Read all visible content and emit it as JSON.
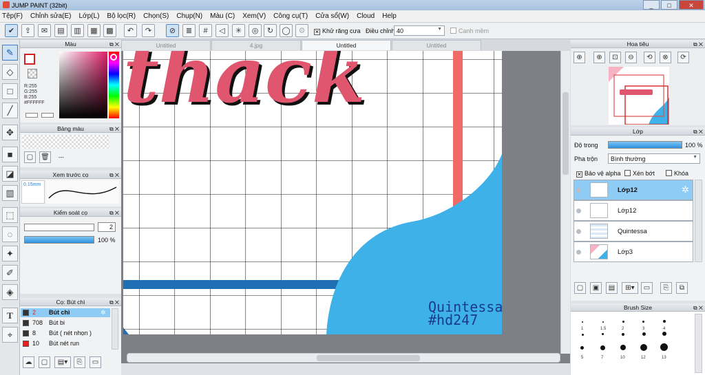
{
  "app": {
    "title": "JUMP PAINT (32bit)"
  },
  "menu": [
    "Tệp(F)",
    "Chỉnh sửa(E)",
    "Lớp(L)",
    "Bộ lọc(R)",
    "Chọn(S)",
    "Chụp(N)",
    "Màu (C)",
    "Xem(V)",
    "Công cụ(T)",
    "Cửa sổ(W)",
    "Cloud",
    "Help"
  ],
  "toolbar": {
    "antialias_label": "Khử răng cưa",
    "adjust_label": "Điều chỉnh",
    "adjust_value": "40",
    "ruler_label": "Canh mềm"
  },
  "tabs": [
    "Untitled",
    "4.jpg",
    "Untitled",
    "Untitled"
  ],
  "panels": {
    "color": {
      "title": "Màu",
      "r": "R:255",
      "g": "G:255",
      "b": "B:255",
      "hex": "#FFFFFF"
    },
    "swatch": {
      "title": "Bảng màu",
      "dash": "---"
    },
    "brush_preview": {
      "title": "Xem trước cọ",
      "size": "0.15mm"
    },
    "brush_control": {
      "title": "Kiểm soát cọ",
      "size_value": "2",
      "opacity_value": "100 %"
    },
    "brush_list": {
      "title": "Cọ: Bút chì",
      "items": [
        {
          "num": "2",
          "name": "Bút chì"
        },
        {
          "num": "708",
          "name": "Bút bi"
        },
        {
          "num": "8",
          "name": "Bút ( nét nhọn )"
        },
        {
          "num": "10",
          "name": "Bút nét run"
        }
      ]
    },
    "navigator": {
      "title": "Hoa tiêu"
    },
    "layers": {
      "title": "Lớp",
      "opacity_label": "Độ trong",
      "opacity_value": "100 %",
      "blend_label": "Pha trộn",
      "blend_value": "Bình thường",
      "protect_alpha": "Bảo vệ alpha",
      "clip": "Xén bớt",
      "lock": "Khóa",
      "items": [
        {
          "name": "Lớp12"
        },
        {
          "name": "Lớp12"
        },
        {
          "name": "Quintessa"
        },
        {
          "name": "Lớp3"
        }
      ]
    },
    "brush_size": {
      "title": "Brush Size",
      "labels": [
        "1",
        "1.5",
        "2",
        "3",
        "4",
        "5",
        "7",
        "10",
        "12",
        "13"
      ]
    }
  },
  "canvas": {
    "title_text": "thack",
    "credit_line1": "Quintessa",
    "credit_line2": "#hd247"
  },
  "colors": {
    "accent_blue": "#3db1e8",
    "title_pink": "#e0566f",
    "stripe_blue": "#1f6fb5",
    "stripe_red": "#ee6b66"
  }
}
